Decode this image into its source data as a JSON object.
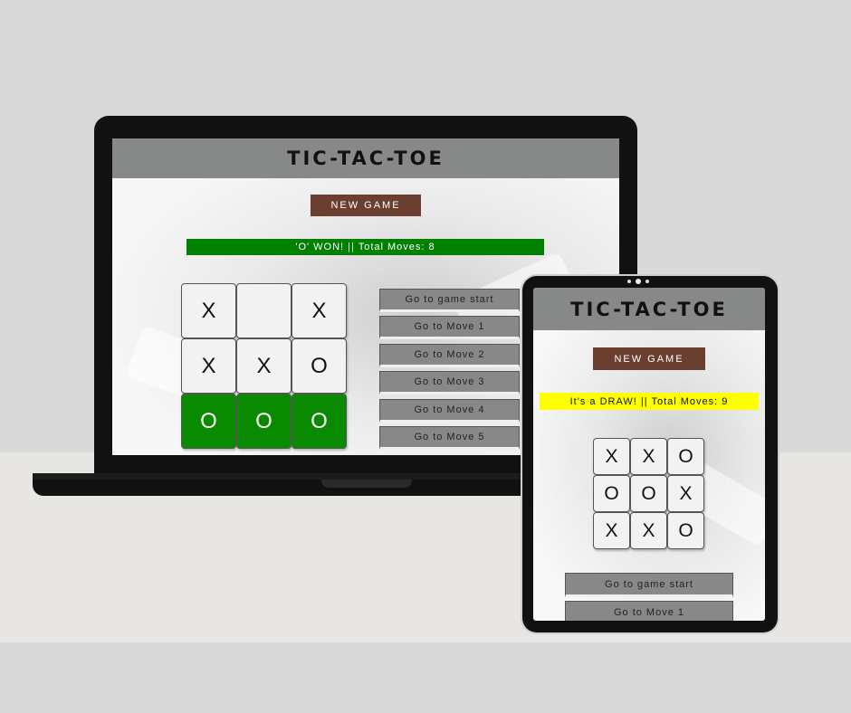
{
  "laptop": {
    "app_title": "TIC-TAC-TOE",
    "new_game_label": "NEW GAME",
    "status": {
      "text": "'O' WON! || Total Moves: 8",
      "background": "#008000",
      "color": "#ffffff"
    },
    "board": [
      {
        "mark": "X",
        "win": false
      },
      {
        "mark": "",
        "win": false
      },
      {
        "mark": "X",
        "win": false
      },
      {
        "mark": "X",
        "win": false
      },
      {
        "mark": "X",
        "win": false
      },
      {
        "mark": "O",
        "win": false
      },
      {
        "mark": "O",
        "win": true
      },
      {
        "mark": "O",
        "win": true
      },
      {
        "mark": "O",
        "win": true
      }
    ],
    "history": [
      "Go to game start",
      "Go to Move 1",
      "Go to Move 2",
      "Go to Move 3",
      "Go to Move 4",
      "Go to Move 5"
    ]
  },
  "tablet": {
    "app_title": "TIC-TAC-TOE",
    "new_game_label": "NEW GAME",
    "status": {
      "text": "It's a DRAW! || Total Moves: 9",
      "background": "#ffff00",
      "color": "#111111"
    },
    "board": [
      {
        "mark": "X",
        "win": false
      },
      {
        "mark": "X",
        "win": false
      },
      {
        "mark": "O",
        "win": false
      },
      {
        "mark": "O",
        "win": false
      },
      {
        "mark": "O",
        "win": false
      },
      {
        "mark": "X",
        "win": false
      },
      {
        "mark": "X",
        "win": false
      },
      {
        "mark": "X",
        "win": false
      },
      {
        "mark": "O",
        "win": false
      }
    ],
    "history": [
      "Go to game start",
      "Go to Move 1"
    ]
  },
  "colors": {
    "header": "#878888",
    "new_game_button": "#6b3f2f",
    "win_cell": "#0a8a00",
    "history_button": "#888888"
  }
}
